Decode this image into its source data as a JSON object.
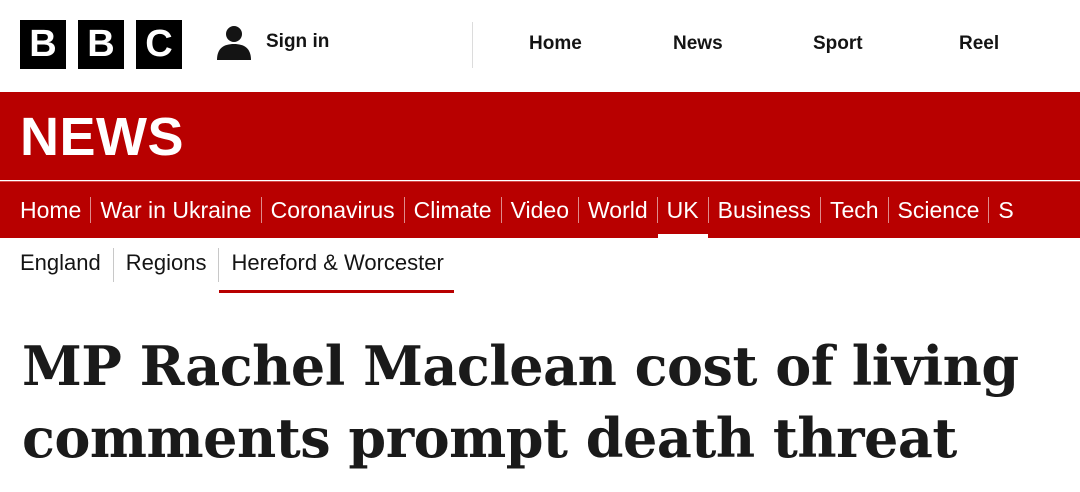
{
  "masthead": {
    "logo_letters": [
      "B",
      "B",
      "C"
    ],
    "signin_label": "Sign in",
    "signin_icon": "user-icon",
    "nav": [
      "Home",
      "News",
      "Sport",
      "Reel"
    ]
  },
  "banner": {
    "wordmark": "NEWS",
    "color": "#b80000"
  },
  "section_nav": {
    "items": [
      "Home",
      "War in Ukraine",
      "Coronavirus",
      "Climate",
      "Video",
      "World",
      "UK",
      "Business",
      "Tech",
      "Science",
      "S"
    ],
    "active": "UK"
  },
  "sub_nav": {
    "items": [
      "England",
      "Regions",
      "Hereford & Worcester"
    ],
    "active": "Hereford & Worcester"
  },
  "article": {
    "headline_lines": [
      "MP Rachel Maclean cost of living",
      "comments prompt death threat"
    ]
  }
}
